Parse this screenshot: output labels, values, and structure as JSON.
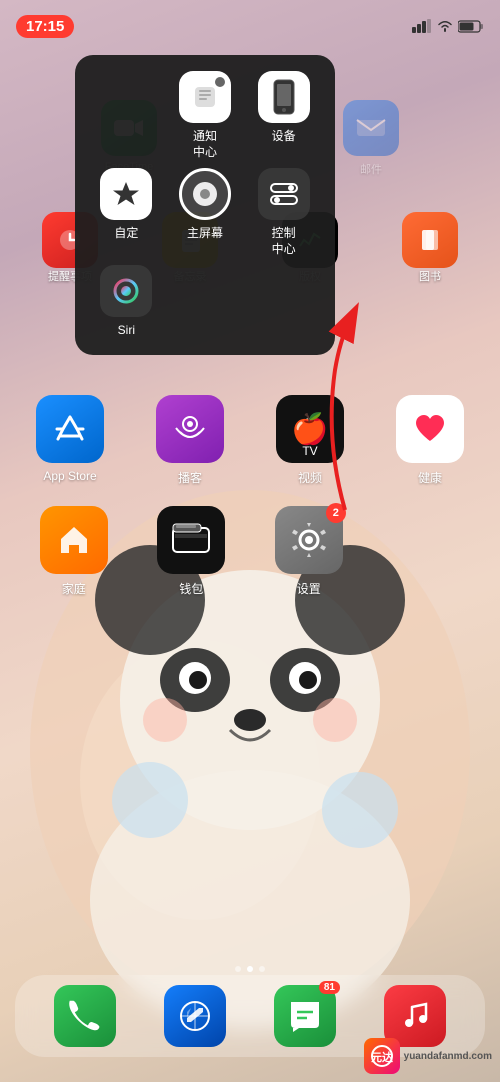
{
  "statusBar": {
    "time": "17:15",
    "signal": "📶",
    "wifi": "WiFi",
    "battery": "🔋"
  },
  "contextMenu": {
    "items": [
      {
        "id": "notification-center",
        "label": "通知\n中心",
        "icon": "notif"
      },
      {
        "id": "device",
        "label": "设备",
        "icon": "device"
      },
      {
        "id": "customize",
        "label": "自定",
        "icon": "star"
      },
      {
        "id": "siri",
        "label": "Siri",
        "icon": "siri"
      },
      {
        "id": "home-screen",
        "label": "主屏幕",
        "icon": "home"
      },
      {
        "id": "control-center",
        "label": "控制\n中心",
        "icon": "toggles"
      }
    ]
  },
  "topApps": [
    {
      "id": "facetime",
      "label": "FaceTime",
      "color": "#34c759",
      "emoji": "📱"
    },
    {
      "id": "mail",
      "label": "邮件",
      "color": "#147efb",
      "emoji": "✉️"
    },
    {
      "id": "reminder",
      "label": "提醒事项",
      "color": "#ff3b30",
      "emoji": "🔔"
    },
    {
      "id": "memo",
      "label": "备忘录",
      "color": "#fecc00",
      "emoji": "📝"
    },
    {
      "id": "books",
      "label": "图书",
      "color": "#ff6b35",
      "emoji": "📚"
    }
  ],
  "appRow1": [
    {
      "id": "appstore",
      "label": "App Store",
      "colorClass": "app-appstore",
      "emoji": "🅰",
      "badge": null
    },
    {
      "id": "podcasts",
      "label": "播客",
      "colorClass": "app-podcasts",
      "emoji": "🎙",
      "badge": null
    },
    {
      "id": "appletv",
      "label": "视频",
      "colorClass": "app-appletv",
      "emoji": "📺",
      "badge": null
    },
    {
      "id": "health",
      "label": "健康",
      "colorClass": "app-health",
      "emoji": "❤️",
      "badge": null
    }
  ],
  "appRow2": [
    {
      "id": "home",
      "label": "家庭",
      "colorClass": "app-home",
      "emoji": "🏠",
      "badge": null
    },
    {
      "id": "wallet",
      "label": "钱包",
      "colorClass": "app-wallet",
      "emoji": "💳",
      "badge": null
    },
    {
      "id": "settings",
      "label": "设置",
      "colorClass": "app-settings",
      "emoji": "⚙️",
      "badge": "2"
    }
  ],
  "dock": [
    {
      "id": "phone",
      "label": "",
      "color": "#34c759",
      "emoji": "📞",
      "badge": null
    },
    {
      "id": "safari",
      "label": "",
      "color": "#147efb",
      "emoji": "🧭",
      "badge": null
    },
    {
      "id": "messages",
      "label": "",
      "color": "#34c759",
      "emoji": "💬",
      "badge": "81"
    },
    {
      "id": "music",
      "label": "",
      "color": "#ff2d55",
      "emoji": "🎵",
      "badge": null
    }
  ],
  "pageDots": [
    "inactive",
    "active",
    "inactive"
  ],
  "watermark": {
    "text": "yuandafanmd.com",
    "shortText": "元达游戏"
  }
}
